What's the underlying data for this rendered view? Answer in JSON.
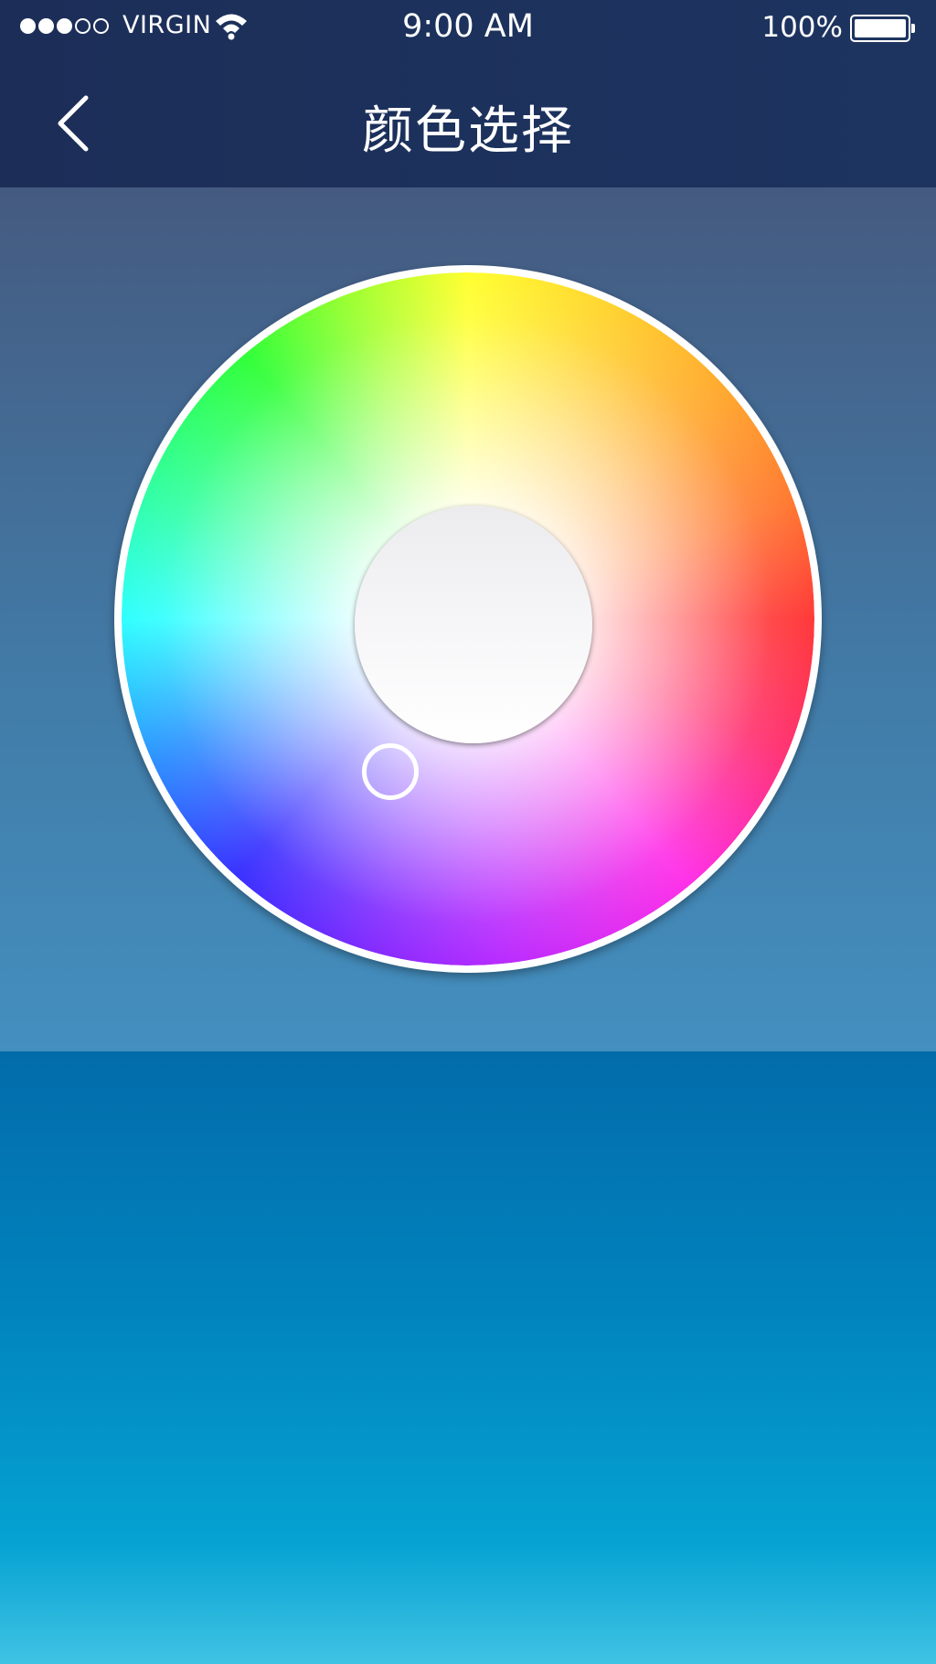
{
  "status_bar": {
    "signal_bars_filled": 3,
    "signal_bars_total": 5,
    "carrier": "VIRGIN",
    "wifi_icon": "wifi-icon",
    "time": "9:00 AM",
    "battery_percent": "100%",
    "battery_icon": "battery-icon"
  },
  "nav": {
    "back_icon": "chevron-left-icon",
    "title": "颜色选择"
  },
  "color_picker": {
    "type": "hue-saturation-wheel",
    "selected_hue_deg": 238,
    "selected_saturation": 0.62,
    "ring_color": "#ffffff"
  },
  "colors": {
    "header_bg": "#1c2e58",
    "picker_bg_top": "#455a80",
    "picker_bg_bottom": "#438fbf",
    "preview_top": "#026caa",
    "preview_bottom": "#3fc3e4",
    "text": "#ffffff"
  }
}
